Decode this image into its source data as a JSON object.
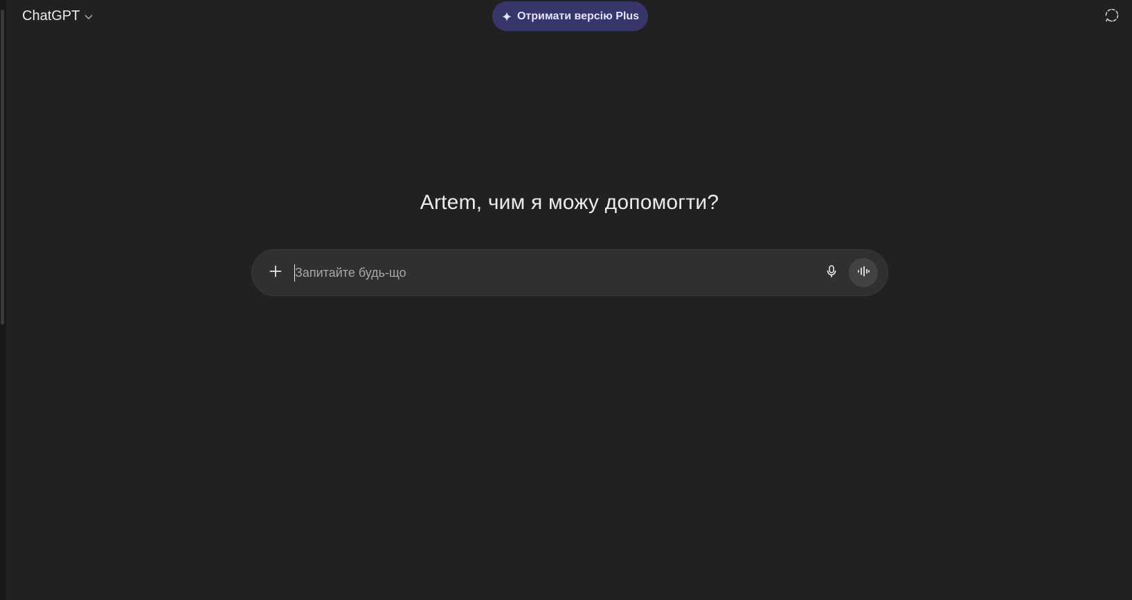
{
  "header": {
    "model_name": "ChatGPT",
    "model_menu_icon": "chevron-down-icon",
    "upgrade_label": "Отримати версію Plus",
    "upgrade_icon": "sparkle-icon",
    "temporary_chat_icon": "temporary-chat-icon"
  },
  "main": {
    "greeting": "Artem, чим я можу допомогти?"
  },
  "composer": {
    "placeholder": "Запитайте будь-що",
    "value": "",
    "attach_icon": "plus-icon",
    "dictate_icon": "microphone-icon",
    "voice_mode_icon": "voice-waveform-icon"
  },
  "colors": {
    "background": "#212121",
    "composer_background": "#303030",
    "upgrade_button": "#373669",
    "voice_button": "#424242",
    "text": "#ececec",
    "placeholder": "#a8a8a8"
  }
}
